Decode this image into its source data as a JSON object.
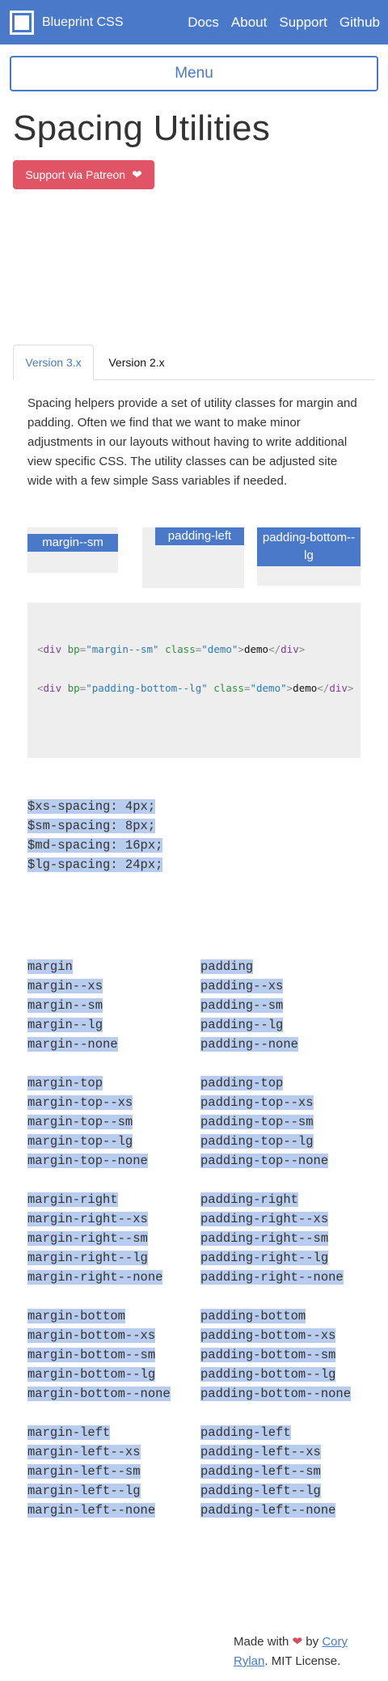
{
  "header": {
    "brand": "Blueprint CSS",
    "nav": [
      "Docs",
      "About",
      "Support",
      "Github"
    ]
  },
  "menu_label": "Menu",
  "page_title": "Spacing Utilities",
  "patreon_label": "Support via Patreon",
  "tabs": [
    {
      "label": "Version 3.x",
      "active": true
    },
    {
      "label": "Version 2.x",
      "active": false
    }
  ],
  "intro": "Spacing helpers provide a set of utility classes for margin and padding. Often we find that we want to make minor adjustments in our layouts without having to write additional view specific CSS. The utility classes can be adjusted site wide with a few simple Sass variables if needed.",
  "demos": [
    "margin--sm",
    "padding-left",
    "padding-bottom--lg"
  ],
  "code": {
    "line1": {
      "attr": "bp",
      "value": "margin--sm",
      "class_attr": "class",
      "class_value": "demo",
      "text": "demo",
      "tag": "div"
    },
    "line2": {
      "attr": "bp",
      "value": "padding-bottom--lg",
      "class_attr": "class",
      "class_value": "demo",
      "text": "demo",
      "tag": "div"
    }
  },
  "sass_vars": [
    "$xs-spacing: 4px;",
    "$sm-spacing: 8px;",
    "$md-spacing: 16px;",
    "$lg-spacing: 24px;"
  ],
  "margin_classes": [
    [
      "margin",
      "margin--xs",
      "margin--sm",
      "margin--lg",
      "margin--none"
    ],
    [
      "margin-top",
      "margin-top--xs",
      "margin-top--sm",
      "margin-top--lg",
      "margin-top--none"
    ],
    [
      "margin-right",
      "margin-right--xs",
      "margin-right--sm",
      "margin-right--lg",
      "margin-right--none"
    ],
    [
      "margin-bottom",
      "margin-bottom--xs",
      "margin-bottom--sm",
      "margin-bottom--lg",
      "margin-bottom--none"
    ],
    [
      "margin-left",
      "margin-left--xs",
      "margin-left--sm",
      "margin-left--lg",
      "margin-left--none"
    ]
  ],
  "padding_classes": [
    [
      "padding",
      "padding--xs",
      "padding--sm",
      "padding--lg",
      "padding--none"
    ],
    [
      "padding-top",
      "padding-top--xs",
      "padding-top--sm",
      "padding-top--lg",
      "padding-top--none"
    ],
    [
      "padding-right",
      "padding-right--xs",
      "padding-right--sm",
      "padding-right--lg",
      "padding-right--none"
    ],
    [
      "padding-bottom",
      "padding-bottom--xs",
      "padding-bottom--sm",
      "padding-bottom--lg",
      "padding-bottom--none"
    ],
    [
      "padding-left",
      "padding-left--xs",
      "padding-left--sm",
      "padding-left--lg",
      "padding-left--none"
    ]
  ],
  "footer": {
    "made_with": "Made with",
    "by": "by",
    "author": "Cory Rylan",
    "license": ". MIT License."
  },
  "colors": {
    "primary": "#4a79c9",
    "patreon": "#e05466",
    "highlight": "#b8cdee"
  },
  "icons": {
    "brand": "blueprint-logo-icon",
    "patreon": "heart-icon",
    "footer": "heart-icon"
  }
}
